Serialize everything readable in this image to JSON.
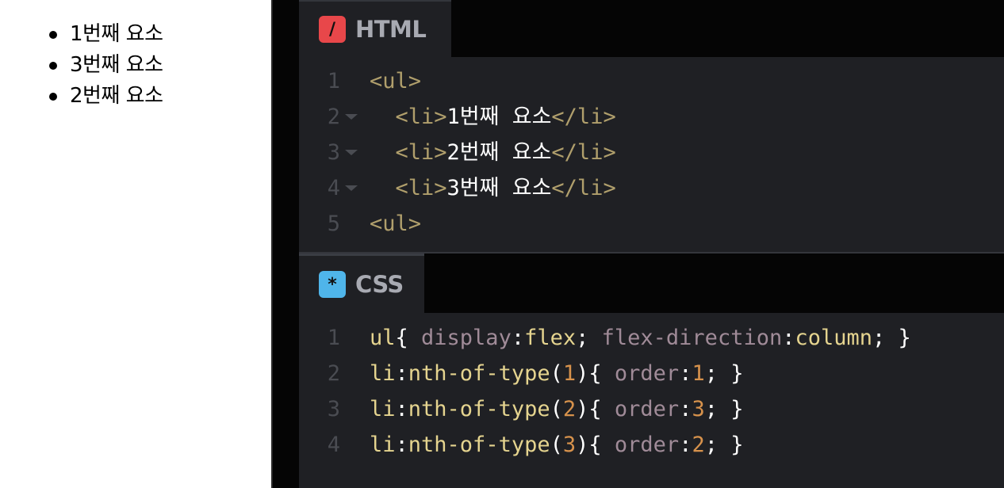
{
  "preview": {
    "items": [
      "1번째 요소",
      "3번째 요소",
      "2번째 요소"
    ]
  },
  "html_pane": {
    "tab_label": "HTML",
    "tab_icon_glyph": "/",
    "tab_icon_color": "#e8474a",
    "lines": [
      {
        "num": "1",
        "fold": false,
        "indent": "",
        "open": "<ul>",
        "text": "",
        "close": ""
      },
      {
        "num": "2",
        "fold": true,
        "indent": "  ",
        "open": "<li>",
        "text": "1번째 요소",
        "close": "</li>"
      },
      {
        "num": "3",
        "fold": true,
        "indent": "  ",
        "open": "<li>",
        "text": "2번째 요소",
        "close": "</li>"
      },
      {
        "num": "4",
        "fold": true,
        "indent": "  ",
        "open": "<li>",
        "text": "3번째 요소",
        "close": "</li>"
      },
      {
        "num": "5",
        "fold": false,
        "indent": "",
        "open": "<ul>",
        "text": "",
        "close": ""
      }
    ]
  },
  "css_pane": {
    "tab_label": "CSS",
    "tab_icon_glyph": "*",
    "tab_icon_color": "#4fb5ea",
    "lines": [
      {
        "num": "1",
        "tokens": [
          {
            "t": "ul",
            "c": "sel"
          },
          {
            "t": "{ ",
            "c": "punc"
          },
          {
            "t": "display",
            "c": "prop"
          },
          {
            "t": ":",
            "c": "punc"
          },
          {
            "t": "flex",
            "c": "val"
          },
          {
            "t": "; ",
            "c": "punc"
          },
          {
            "t": "flex-direction",
            "c": "prop"
          },
          {
            "t": ":",
            "c": "punc"
          },
          {
            "t": "column",
            "c": "val"
          },
          {
            "t": "; }",
            "c": "punc"
          }
        ]
      },
      {
        "num": "2",
        "tokens": [
          {
            "t": "li",
            "c": "sel"
          },
          {
            "t": ":",
            "c": "punc"
          },
          {
            "t": "nth-of-type",
            "c": "sel"
          },
          {
            "t": "(",
            "c": "punc"
          },
          {
            "t": "1",
            "c": "num"
          },
          {
            "t": "){ ",
            "c": "punc"
          },
          {
            "t": "order",
            "c": "prop"
          },
          {
            "t": ":",
            "c": "punc"
          },
          {
            "t": "1",
            "c": "num"
          },
          {
            "t": "; }",
            "c": "punc"
          }
        ]
      },
      {
        "num": "3",
        "tokens": [
          {
            "t": "li",
            "c": "sel"
          },
          {
            "t": ":",
            "c": "punc"
          },
          {
            "t": "nth-of-type",
            "c": "sel"
          },
          {
            "t": "(",
            "c": "punc"
          },
          {
            "t": "2",
            "c": "num"
          },
          {
            "t": "){ ",
            "c": "punc"
          },
          {
            "t": "order",
            "c": "prop"
          },
          {
            "t": ":",
            "c": "punc"
          },
          {
            "t": "3",
            "c": "num"
          },
          {
            "t": "; }",
            "c": "punc"
          }
        ]
      },
      {
        "num": "4",
        "tokens": [
          {
            "t": "li",
            "c": "sel"
          },
          {
            "t": ":",
            "c": "punc"
          },
          {
            "t": "nth-of-type",
            "c": "sel"
          },
          {
            "t": "(",
            "c": "punc"
          },
          {
            "t": "3",
            "c": "num"
          },
          {
            "t": "){ ",
            "c": "punc"
          },
          {
            "t": "order",
            "c": "prop"
          },
          {
            "t": ":",
            "c": "punc"
          },
          {
            "t": "2",
            "c": "num"
          },
          {
            "t": "; }",
            "c": "punc"
          }
        ]
      }
    ]
  }
}
